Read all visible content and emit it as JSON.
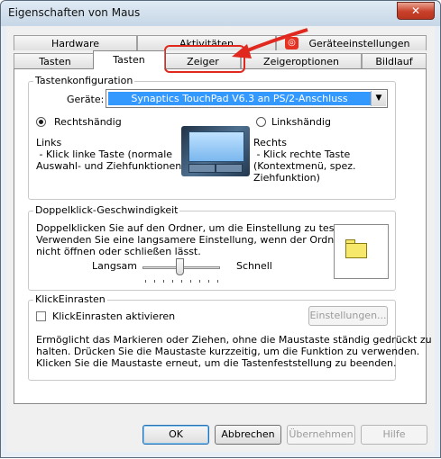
{
  "window": {
    "title": "Eigenschaften von Maus",
    "close_icon": "close-icon"
  },
  "tabs_row1": [
    {
      "label": "Hardware"
    },
    {
      "label": "Aktivitäten"
    },
    {
      "label": "Geräteeinstellungen"
    }
  ],
  "tabs_row2": [
    {
      "label": "Tasten"
    },
    {
      "label": "Tasten"
    },
    {
      "label": "Zeiger"
    },
    {
      "label": "Zeigeroptionen"
    },
    {
      "label": "Bildlauf"
    }
  ],
  "tastenkonfiguration": {
    "title": "Tastenkonfiguration",
    "device_label": "Geräte:",
    "device_value": "Synaptics TouchPad V6.3 an PS/2-Anschluss",
    "right_handed": "Rechtshändig",
    "left_handed": "Linkshändig",
    "left_heading": "Links",
    "left_desc_1": " - Klick linke Taste (normale",
    "left_desc_2": "Auswahl- und Ziehfunktionen)",
    "right_heading": "Rechts",
    "right_desc_1": " - Klick rechte Taste",
    "right_desc_2": "(Kontextmenü, spez.",
    "right_desc_3": "Ziehfunktion)"
  },
  "doubleclick": {
    "title": "Doppelklick-Geschwindigkeit",
    "desc_1": "Doppelklicken Sie auf den Ordner, um die Einstellung zu testen.",
    "desc_2": "Verwenden Sie eine langsamere Einstellung, wenn der Ordner sich",
    "desc_3": "nicht öffnen oder schließen lässt.",
    "slow": "Langsam",
    "fast": "Schnell",
    "speed": 0.45
  },
  "clicklock": {
    "title": "KlickEinrasten",
    "checkbox_label": "KlickEinrasten aktivieren",
    "settings_button": "Einstellungen...",
    "desc_1": "Ermöglicht das Markieren oder Ziehen, ohne die Maustaste ständig gedrückt zu",
    "desc_2": "halten. Drücken Sie die Maustaste kurzzeitig, um die Funktion zu verwenden.",
    "desc_3": "Klicken Sie die Maustaste erneut, um die Tastenfeststellung zu beenden."
  },
  "buttons": {
    "ok": "OK",
    "cancel": "Abbrechen",
    "apply": "Übernehmen",
    "help": "Hilfe"
  },
  "colors": {
    "highlight": "#e0281e",
    "selection": "#3399ff"
  }
}
